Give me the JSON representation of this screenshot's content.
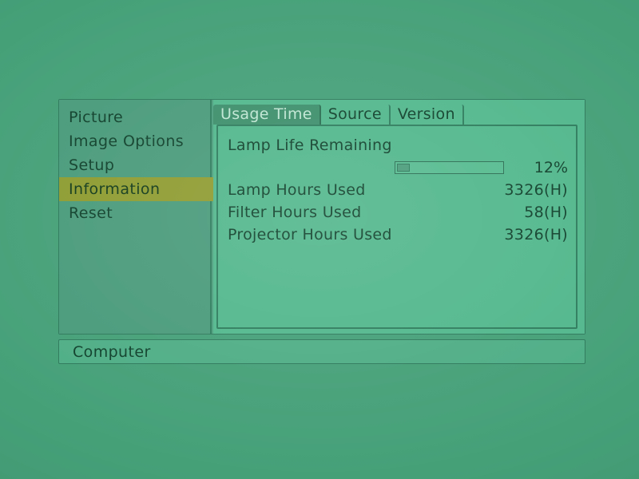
{
  "status_bar": {
    "source_label": "Computer"
  },
  "sidebar": {
    "items": [
      {
        "label": "Picture",
        "selected": false
      },
      {
        "label": "Image Options",
        "selected": false
      },
      {
        "label": "Setup",
        "selected": false
      },
      {
        "label": "Information",
        "selected": true
      },
      {
        "label": "Reset",
        "selected": false
      }
    ]
  },
  "tabs": [
    {
      "label": "Usage Time",
      "active": true
    },
    {
      "label": "Source",
      "active": false
    },
    {
      "label": "Version",
      "active": false
    }
  ],
  "usage_time": {
    "lamp_life": {
      "label": "Lamp Life Remaining",
      "percent_text": "12%",
      "percent_value": 12
    },
    "rows": [
      {
        "label": "Lamp Hours Used",
        "value": "3326(H)"
      },
      {
        "label": "Filter Hours Used",
        "value": "58(H)"
      },
      {
        "label": "Projector Hours Used",
        "value": "3326(H)"
      }
    ]
  },
  "colors": {
    "background": "#45a078",
    "panel": "#4c9f7e",
    "sidebar": "#4a9b7c",
    "content": "#52b78c",
    "highlight": "#8e9c31",
    "active_tab": "#3d8f6c",
    "text": "#10412c",
    "border": "#2f7d5e"
  }
}
